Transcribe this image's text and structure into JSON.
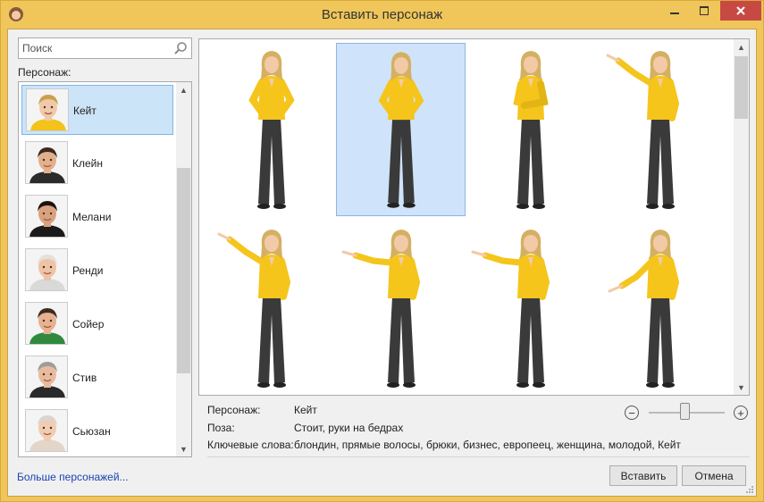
{
  "window": {
    "title": "Вставить персонаж"
  },
  "search": {
    "placeholder": "Поиск"
  },
  "left": {
    "label": "Персонаж:",
    "characters": [
      {
        "name": "Кейт",
        "hair": "#c9a04e",
        "shirt": "#f3c31b",
        "skin": "#f1c9a8",
        "selected": true
      },
      {
        "name": "Клейн",
        "hair": "#3a2a20",
        "shirt": "#2b2b2b",
        "skin": "#e3b08c",
        "selected": false
      },
      {
        "name": "Мелани",
        "hair": "#1d1410",
        "shirt": "#1b1b1b",
        "skin": "#d9a27d",
        "selected": false
      },
      {
        "name": "Ренди",
        "hair": "#e4e0da",
        "shirt": "#d9d9d9",
        "skin": "#efc3a6",
        "selected": false
      },
      {
        "name": "Сойер",
        "hair": "#3c2c22",
        "shirt": "#2f8a3d",
        "skin": "#e6b290",
        "selected": false
      },
      {
        "name": "Стив",
        "hair": "#9d9d9d",
        "shirt": "#2a2a2a",
        "skin": "#e9bb9c",
        "selected": false
      },
      {
        "name": "Сьюзан",
        "hair": "#d8d6d2",
        "shirt": "#e3d6c8",
        "skin": "#f1ccb1",
        "selected": false
      }
    ],
    "more_link": "Больше персонажей..."
  },
  "poses": [
    {
      "pose": "hands-on-hips",
      "selected": false
    },
    {
      "pose": "hands-on-hips",
      "selected": true
    },
    {
      "pose": "arms-crossed",
      "selected": false
    },
    {
      "pose": "pointing-up-left",
      "selected": false
    },
    {
      "pose": "pointing-up-left",
      "selected": false
    },
    {
      "pose": "pointing-left",
      "selected": false
    },
    {
      "pose": "pointing-left",
      "selected": false
    },
    {
      "pose": "pointing-down-left",
      "selected": false
    }
  ],
  "info": {
    "character_label": "Персонаж:",
    "character_value": "Кейт",
    "pose_label": "Поза:",
    "pose_value": "Стоит, руки на бедрах",
    "keywords_label": "Ключевые слова:",
    "keywords_value": "блондин, прямые волосы, брюки, бизнес, европеец, женщина, молодой, Кейт"
  },
  "zoom": {
    "minus": "−",
    "plus": "+",
    "level": 0.45
  },
  "buttons": {
    "insert": "Вставить",
    "cancel": "Отмена"
  },
  "colors": {
    "shirt": "#f5c51c",
    "pants": "#3a3a3a",
    "hair": "#d4b062",
    "skin": "#f2caa8",
    "selection": "#cfe3fb"
  }
}
